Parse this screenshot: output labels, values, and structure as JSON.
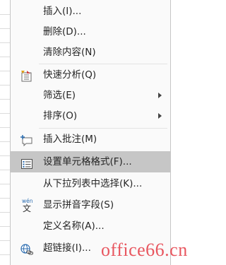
{
  "menu": {
    "items": [
      {
        "label": "插入(I)...",
        "icon": "",
        "submenu": false
      },
      {
        "label": "删除(D)...",
        "icon": "",
        "submenu": false
      },
      {
        "label": "清除内容(N)",
        "icon": "",
        "submenu": false
      },
      {
        "label": "快速分析(Q)",
        "icon": "quick-analysis-icon",
        "submenu": false
      },
      {
        "label": "筛选(E)",
        "icon": "",
        "submenu": true
      },
      {
        "label": "排序(O)",
        "icon": "",
        "submenu": true
      },
      {
        "label": "插入批注(M)",
        "icon": "insert-comment-icon",
        "submenu": false
      },
      {
        "label": "设置单元格格式(F)...",
        "icon": "format-cells-icon",
        "submenu": false,
        "highlighted": true
      },
      {
        "label": "从下拉列表中选择(K)...",
        "icon": "",
        "submenu": false
      },
      {
        "label": "显示拼音字段(S)",
        "icon": "phonetic-icon",
        "submenu": false
      },
      {
        "label": "定义名称(A)...",
        "icon": "",
        "submenu": false
      },
      {
        "label": "超链接(I)...",
        "icon": "hyperlink-icon",
        "submenu": false
      }
    ]
  },
  "phonetic_icon_text": {
    "top": "wén",
    "bottom": "文"
  },
  "watermark": "office66.cn",
  "colors": {
    "highlight": "#c6c6c6",
    "menu_bg": "#fafafa",
    "watermark": "#e8565f",
    "icon_blue": "#2b6cb0"
  }
}
